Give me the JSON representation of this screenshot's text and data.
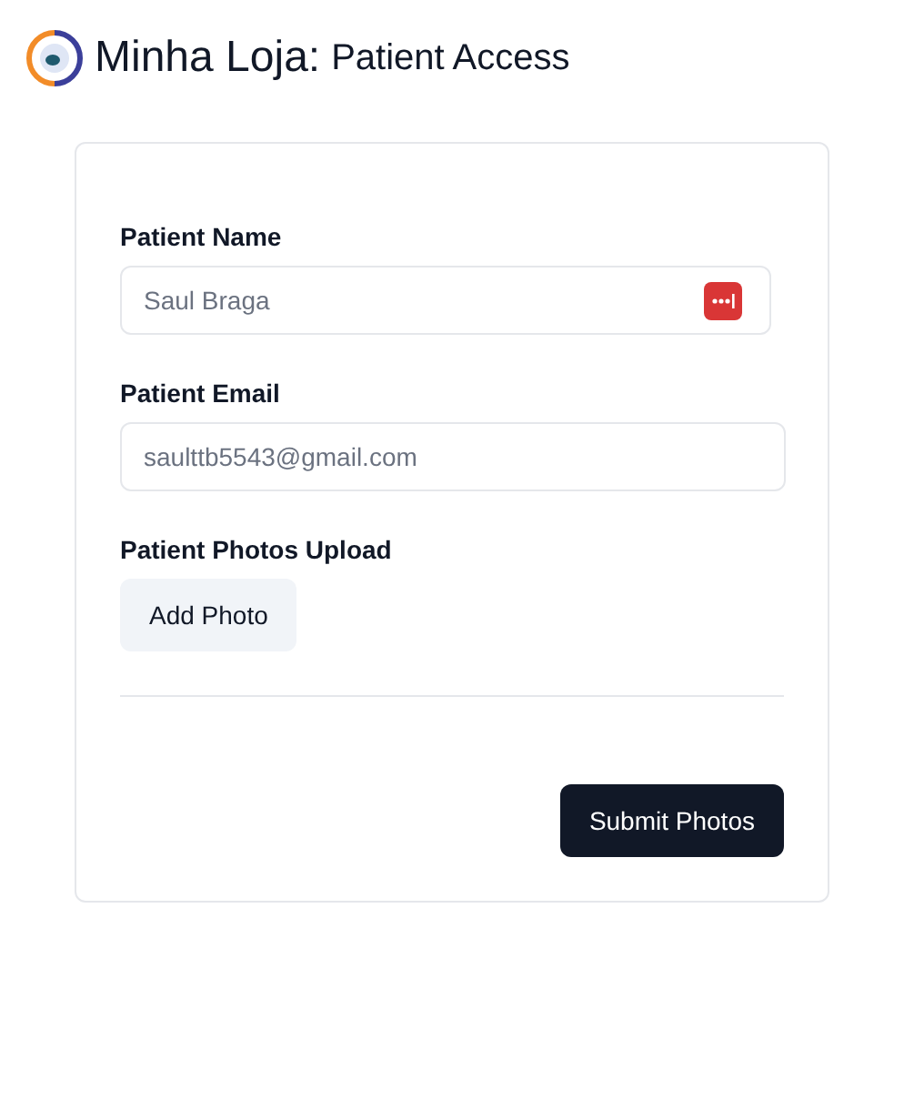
{
  "header": {
    "brand": "Minha Loja:",
    "title": "Patient Access"
  },
  "fields": [
    {
      "label": "Patient Name",
      "value": "Saul Braga",
      "password_manager": true
    },
    {
      "label": "Patient Email",
      "value": "saulttb5543@gmail.com",
      "password_manager": false
    }
  ],
  "upload": {
    "label": "Patient Photos Upload",
    "button": "Add Photo"
  },
  "submit": "Submit Photos"
}
